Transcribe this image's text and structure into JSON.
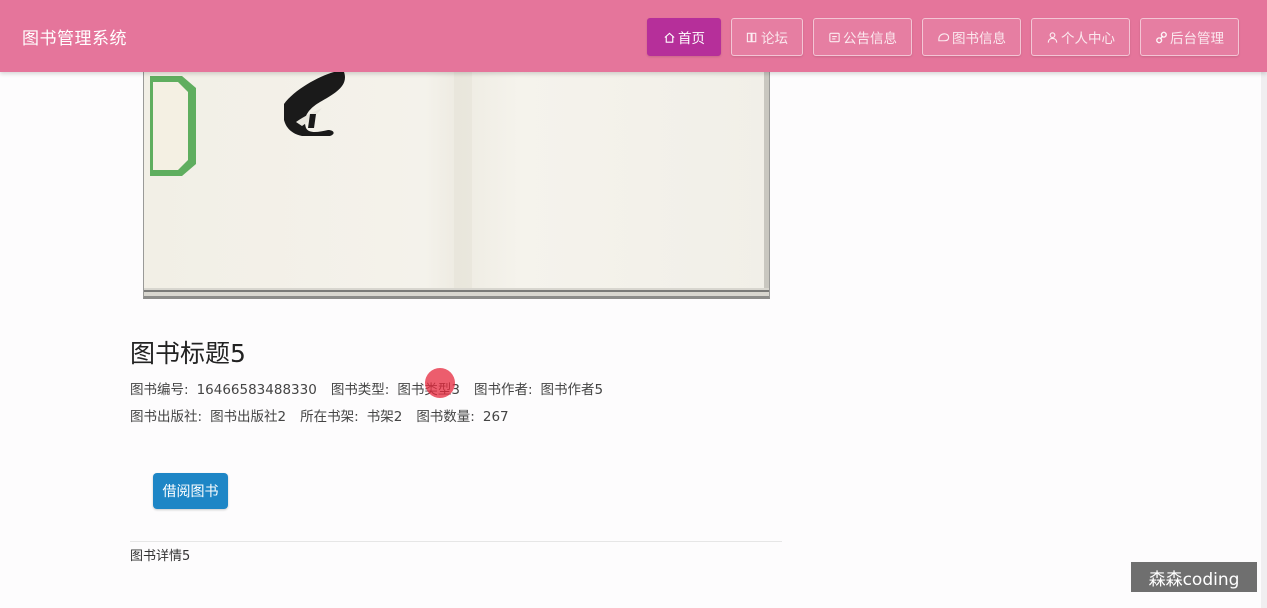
{
  "app": {
    "brand": "图书管理系统"
  },
  "nav": [
    {
      "label": "首页",
      "icon": "home-icon",
      "active": true
    },
    {
      "label": "论坛",
      "icon": "forum-icon",
      "active": false
    },
    {
      "label": "公告信息",
      "icon": "notice-icon",
      "active": false
    },
    {
      "label": "图书信息",
      "icon": "book-icon",
      "active": false
    },
    {
      "label": "个人中心",
      "icon": "user-icon",
      "active": false
    },
    {
      "label": "后台管理",
      "icon": "link-icon",
      "active": false
    }
  ],
  "book": {
    "title": "图书标题5",
    "fields": {
      "number_label": "图书编号:",
      "number_value": "16466583488330",
      "type_label": "图书类型:",
      "type_value": "图书类型3",
      "author_label": "图书作者:",
      "author_value": "图书作者5",
      "publisher_label": "图书出版社:",
      "publisher_value": "图书出版社2",
      "shelf_label": "所在书架:",
      "shelf_value": "书架2",
      "quantity_label": "图书数量:",
      "quantity_value": "267"
    },
    "borrow_button": "借阅图书",
    "detail": "图书详情5"
  },
  "watermark": "森森coding",
  "colors": {
    "navbar": "#e5759b",
    "nav_active": "#b62f9a",
    "borrow_button": "#1e86c6"
  }
}
